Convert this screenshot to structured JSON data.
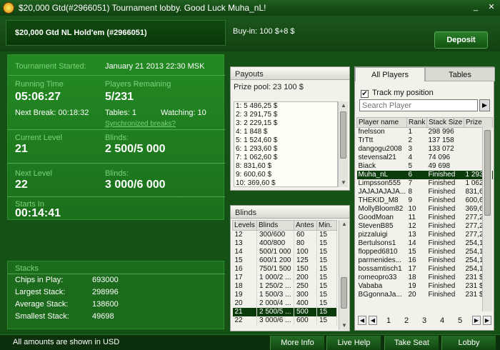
{
  "window": {
    "title": "$20,000 Gtd(#2966051) Tournament lobby. Good Luck Muha_nL!",
    "minimize_icon": "minimize-icon",
    "close_icon": "close-icon"
  },
  "header": {
    "tournament_name": "$20,000 Gtd NL Hold'em (#2966051)",
    "buyin": "Buy-in: 100 $+8 $",
    "deposit_label": "Deposit"
  },
  "info": {
    "started_label": "Tournament Started:",
    "started_value": "January 21 2013  22:30 MSK",
    "running_label": "Running Time",
    "running_value": "05:06:27",
    "players_label": "Players Remaining",
    "players_value": "5/231",
    "next_break": "Next Break: 00:18:32",
    "tables": "Tables: 1",
    "watching": "Watching: 10",
    "sync_link": "Synchronized breaks?",
    "current_level_label": "Current Level",
    "current_level_value": "21",
    "current_blinds_label": "Blinds:",
    "current_blinds_value": "2 500/5 000",
    "next_level_label": "Next Level",
    "next_level_value": "22",
    "next_blinds_label": "Blinds:",
    "next_blinds_value": "3 000/6 000",
    "starts_in_label": "Starts In",
    "starts_in_value": "00:14:41"
  },
  "stacks": {
    "label": "Stacks",
    "rows": [
      {
        "name": "Chips in Play:",
        "value": "693000"
      },
      {
        "name": "Largest Stack:",
        "value": "298996"
      },
      {
        "name": "Average Stack:",
        "value": "138600"
      },
      {
        "name": "Smallest Stack:",
        "value": "49698"
      }
    ]
  },
  "payouts": {
    "title": "Payouts",
    "prize_pool": "Prize pool: 23 100 $",
    "items": [
      "1: 5 486,25 $",
      "2: 3 291,75 $",
      "3: 2 229,15 $",
      "4: 1 848 $",
      "5: 1 524,60 $",
      "6: 1 293,60 $",
      "7: 1 062,60 $",
      "8: 831,60 $",
      "9: 600,60 $",
      "10: 369,60 $"
    ]
  },
  "blinds": {
    "title": "Blinds",
    "headers": [
      "Levels",
      "Blinds",
      "Antes",
      "Min."
    ],
    "rows": [
      [
        "12",
        "300/600",
        "60",
        "15"
      ],
      [
        "13",
        "400/800",
        "80",
        "15"
      ],
      [
        "14",
        "500/1 000",
        "100",
        "15"
      ],
      [
        "15",
        "600/1 200",
        "125",
        "15"
      ],
      [
        "16",
        "750/1 500",
        "150",
        "15"
      ],
      [
        "17",
        "1 000/2 ...",
        "200",
        "15"
      ],
      [
        "18",
        "1 250/2 ...",
        "250",
        "15"
      ],
      [
        "19",
        "1 500/3 ...",
        "300",
        "15"
      ],
      [
        "20",
        "2 000/4 ...",
        "400",
        "15"
      ],
      [
        "21",
        "2 500/5 ...",
        "500",
        "15"
      ],
      [
        "22",
        "3 000/6 ...",
        "600",
        "15"
      ]
    ],
    "selected_row": 9
  },
  "players": {
    "tab_all": "All Players",
    "tab_tables": "Tables",
    "track_label": "Track my position",
    "track_checked": "✔",
    "search_placeholder": "Search Player",
    "headers": [
      "Player name",
      "Rank",
      "Stack Size",
      "Prize"
    ],
    "rows": [
      [
        "fnelsson",
        "1",
        "298 996",
        ""
      ],
      [
        "TrTtt",
        "2",
        "137 158",
        ""
      ],
      [
        "dangogu2008",
        "3",
        "133 072",
        ""
      ],
      [
        "stevensal21",
        "4",
        "74 096",
        ""
      ],
      [
        "Biack",
        "5",
        "49 698",
        ""
      ],
      [
        "Muha_nL",
        "6",
        "Finished",
        "1 293,..."
      ],
      [
        "Limpsson555",
        "7",
        "Finished",
        "1 062,..."
      ],
      [
        "JAJAJAJAJA...",
        "8",
        "Finished",
        "831,6..."
      ],
      [
        "THEKID_M8",
        "9",
        "Finished",
        "600,6..."
      ],
      [
        "MollyBloom82",
        "10",
        "Finished",
        "369,6..."
      ],
      [
        "GoodMoan",
        "11",
        "Finished",
        "277,2..."
      ],
      [
        "StevenB85",
        "12",
        "Finished",
        "277,2..."
      ],
      [
        "pizzaluigi",
        "13",
        "Finished",
        "277,2..."
      ],
      [
        "Bertulsons1",
        "14",
        "Finished",
        "254,1..."
      ],
      [
        "flopped6810",
        "15",
        "Finished",
        "254,1..."
      ],
      [
        "parmenides...",
        "16",
        "Finished",
        "254,1..."
      ],
      [
        "bossamtisch1",
        "17",
        "Finished",
        "254,1..."
      ],
      [
        "romeopro33",
        "18",
        "Finished",
        "231 $"
      ],
      [
        "Vababa",
        "19",
        "Finished",
        "231 $"
      ],
      [
        "BGgonnaJa...",
        "20",
        "Finished",
        "231 $"
      ]
    ],
    "selected_row": 5,
    "pages": [
      "1",
      "2",
      "3",
      "4",
      "5"
    ]
  },
  "footer": {
    "note": "All amounts are shown in USD",
    "buttons": [
      "More Info",
      "Live Help",
      "Take Seat",
      "Lobby"
    ]
  },
  "colors": {
    "accent": "#238a23",
    "selected": "#0b3b0b",
    "background": "#155015"
  }
}
